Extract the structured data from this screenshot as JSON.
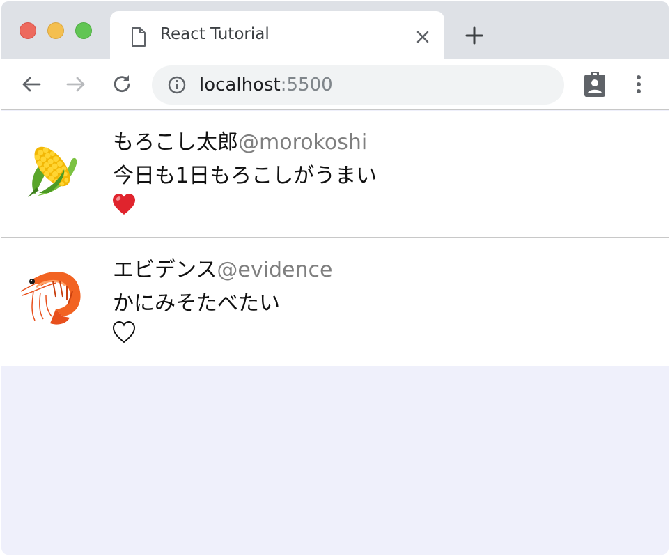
{
  "browser": {
    "tab_title": "React Tutorial",
    "url_host": "localhost",
    "url_port": ":5500"
  },
  "tweets": [
    {
      "avatar": "corn-emoji",
      "display_name": "もろこし太郎",
      "handle": "@morokoshi",
      "content": "今日も1日もろこしがうまい",
      "liked": true,
      "like_icon": "heart-filled-icon",
      "like_color": "#e0242d"
    },
    {
      "avatar": "shrimp-emoji",
      "display_name": "エビデンス",
      "handle": "@evidence",
      "content": "かにみそたべたい",
      "liked": false,
      "like_icon": "heart-outline-icon",
      "like_color": "#111111"
    }
  ]
}
